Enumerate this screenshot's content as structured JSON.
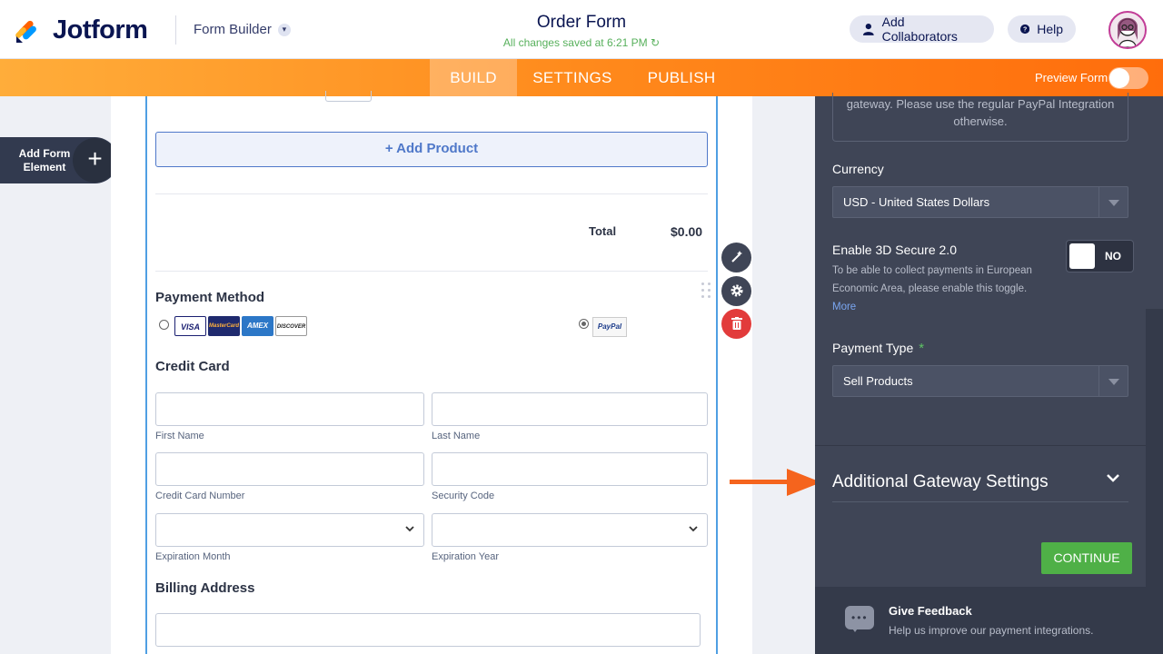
{
  "header": {
    "brand": "Jotform",
    "app_menu": "Form Builder",
    "form_title": "Order Form",
    "save_status": "All changes saved at 6:21 PM",
    "add_collaborators": "Add Collaborators",
    "help": "Help"
  },
  "nav": {
    "tabs": [
      "BUILD",
      "SETTINGS",
      "PUBLISH"
    ],
    "active_tab": "BUILD",
    "preview_label": "Preview Form"
  },
  "left": {
    "add_element_label": "Add Form Element"
  },
  "form": {
    "add_product": "+ Add Product",
    "total_label": "Total",
    "total_value": "$0.00",
    "payment_method_title": "Payment Method",
    "cards": [
      "VISA",
      "MasterCard",
      "AMEX",
      "DISCOVER"
    ],
    "paypal_label": "PayPal",
    "credit_card_title": "Credit Card",
    "fields": {
      "first_name": "First Name",
      "last_name": "Last Name",
      "cc_number": "Credit Card Number",
      "security_code": "Security Code",
      "exp_month": "Expiration Month",
      "exp_year": "Expiration Year"
    },
    "billing_address_title": "Billing Address"
  },
  "panel": {
    "info_text": "gateway. Please use the regular PayPal Integration otherwise.",
    "currency_label": "Currency",
    "currency_value": "USD - United States Dollars",
    "secure_label": "Enable 3D Secure 2.0",
    "secure_desc": "To be able to collect payments in European Economic Area, please enable this toggle.",
    "secure_more": "More",
    "secure_toggle": "NO",
    "payment_type_label": "Payment Type",
    "payment_type_value": "Sell Products",
    "additional_settings": "Additional Gateway Settings",
    "continue": "CONTINUE",
    "feedback_title": "Give Feedback",
    "feedback_sub": "Help us improve our payment integrations."
  },
  "colors": {
    "brand_navy": "#0a1551",
    "orange": "#ff6d0c",
    "panel_bg": "#3f4556",
    "continue_green": "#4fb047",
    "delete_red": "#e23b3b",
    "arrow": "#f5641d"
  }
}
